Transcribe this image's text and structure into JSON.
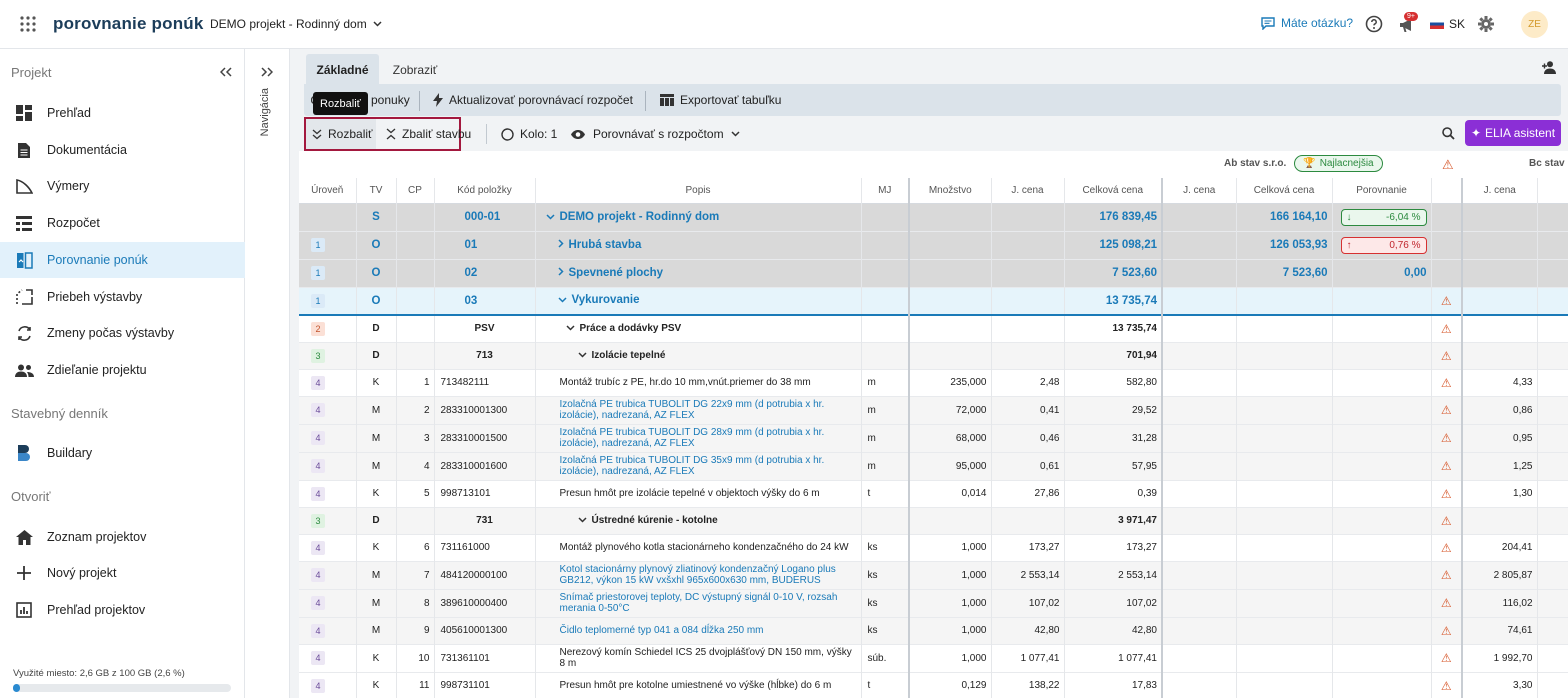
{
  "app": {
    "title": "porovnanie ponúk",
    "project": "DEMO projekt - Rodinný dom",
    "help": "Máte otázku?",
    "notif_badge": "9+",
    "lang": "SK",
    "avatar": "ZE"
  },
  "sidebar": {
    "section_project": "Projekt",
    "items": [
      {
        "label": "Prehľad",
        "icon": "grid-icon"
      },
      {
        "label": "Dokumentácia",
        "icon": "document-icon"
      },
      {
        "label": "Výmery",
        "icon": "ruler-icon"
      },
      {
        "label": "Rozpočet",
        "icon": "budget-icon"
      },
      {
        "label": "Porovnanie ponúk",
        "icon": "compare-icon"
      },
      {
        "label": "Priebeh výstavby",
        "icon": "progress-icon"
      },
      {
        "label": "Zmeny počas výstavby",
        "icon": "changes-icon"
      },
      {
        "label": "Zdieľanie projektu",
        "icon": "users-icon"
      }
    ],
    "section_diary": "Stavebný denník",
    "diary_items": [
      {
        "label": "Buildary",
        "icon": "buildary-icon"
      }
    ],
    "section_open": "Otvoriť",
    "open_items": [
      {
        "label": "Zoznam projektov",
        "icon": "home-icon"
      },
      {
        "label": "Nový projekt",
        "icon": "plus-icon"
      },
      {
        "label": "Prehľad projektov",
        "icon": "chart-icon"
      }
    ],
    "storage": "Využité miesto: 2,6 GB z 100 GB (2,6 %)",
    "storage_fraction": 0.026
  },
  "nav_label": "Navigácia",
  "tabs": [
    {
      "label": "Základné"
    },
    {
      "label": "Zobraziť"
    }
  ],
  "toolbar1": {
    "offers": "ponuky",
    "update": "Aktualizovať porovnávací rozpočet",
    "export": "Exportovať tabuľku"
  },
  "tooltip": "Rozbaliť",
  "toolbar2": {
    "expand": "Rozbaliť",
    "collapse": "Zbaliť stavbu",
    "round": "Kolo: 1",
    "compare": "Porovnávať s rozpočtom",
    "assistant": "ELIA asistent"
  },
  "offer1": {
    "name": "Ab stav s.r.o.",
    "badge": "Najlacnejšia"
  },
  "offer2": {
    "name": "Bc stav"
  },
  "columns": [
    "Úroveň",
    "TV",
    "CP",
    "Kód položky",
    "Popis",
    "MJ",
    "Množstvo",
    "J. cena",
    "Celková cena",
    "J. cena",
    "Celková cena",
    "Porovnanie",
    "",
    "J. cena"
  ],
  "rows": [
    {
      "lvl": "",
      "tv": "S",
      "cp": "",
      "code": "000-01",
      "desc": "DEMO projekt - Rodinný dom",
      "mj": "",
      "qty": "",
      "unit": "",
      "total": "176 839,45",
      "o1u": "",
      "o1t": "166 164,10",
      "cmp": "-6,04 %",
      "cmpType": "down",
      "warn": "",
      "o2u": "",
      "kind": "s"
    },
    {
      "lvl": "1",
      "tv": "O",
      "cp": "",
      "code": "01",
      "desc": "Hrubá stavba",
      "mj": "",
      "qty": "",
      "unit": "",
      "total": "125 098,21",
      "o1u": "",
      "o1t": "126 053,93",
      "cmp": "0,76 %",
      "cmpType": "up",
      "warn": "",
      "o2u": "",
      "kind": "o"
    },
    {
      "lvl": "1",
      "tv": "O",
      "cp": "",
      "code": "02",
      "desc": "Spevnené plochy",
      "mj": "",
      "qty": "",
      "unit": "",
      "total": "7 523,60",
      "o1u": "",
      "o1t": "7 523,60",
      "cmp": "0,00",
      "cmpType": "plain",
      "warn": "",
      "o2u": "",
      "kind": "o"
    },
    {
      "lvl": "1",
      "tv": "O",
      "cp": "",
      "code": "03",
      "desc": "Vykurovanie",
      "mj": "",
      "qty": "",
      "unit": "",
      "total": "13 735,74",
      "o1u": "",
      "o1t": "",
      "cmp": "",
      "cmpType": "",
      "warn": "⚠",
      "o2u": "",
      "kind": "osel"
    },
    {
      "lvl": "2",
      "tv": "D",
      "cp": "",
      "code": "PSV",
      "desc": "Práce a dodávky PSV",
      "mj": "",
      "qty": "",
      "unit": "",
      "total": "13 735,74",
      "o1u": "",
      "o1t": "",
      "cmp": "",
      "cmpType": "",
      "warn": "⚠",
      "o2u": "",
      "kind": "d2"
    },
    {
      "lvl": "3",
      "tv": "D",
      "cp": "",
      "code": "713",
      "desc": "Izolácie tepelné",
      "mj": "",
      "qty": "",
      "unit": "",
      "total": "701,94",
      "o1u": "",
      "o1t": "",
      "cmp": "",
      "cmpType": "",
      "warn": "⚠",
      "o2u": "",
      "kind": "d3"
    },
    {
      "lvl": "4",
      "tv": "K",
      "cp": "1",
      "code": "713482111",
      "desc": "Montáž trubíc z PE, hr.do 10 mm,vnút.priemer do 38 mm",
      "mj": "m",
      "qty": "235,000",
      "unit": "2,48",
      "total": "582,80",
      "o1u": "",
      "o1t": "",
      "cmp": "",
      "cmpType": "",
      "warn": "⚠",
      "o2u": "4,33",
      "kind": "k"
    },
    {
      "lvl": "4",
      "tv": "M",
      "cp": "2",
      "code": "283310001300",
      "desc": "Izolačná PE trubica TUBOLIT DG 22x9 mm (d potrubia x hr. izolácie), nadrezaná, AZ FLEX",
      "mj": "m",
      "qty": "72,000",
      "unit": "0,41",
      "total": "29,52",
      "o1u": "",
      "o1t": "",
      "cmp": "",
      "cmpType": "",
      "warn": "⚠",
      "o2u": "0,86",
      "kind": "m"
    },
    {
      "lvl": "4",
      "tv": "M",
      "cp": "3",
      "code": "283310001500",
      "desc": "Izolačná PE trubica TUBOLIT DG 28x9 mm (d potrubia x hr. izolácie), nadrezaná, AZ FLEX",
      "mj": "m",
      "qty": "68,000",
      "unit": "0,46",
      "total": "31,28",
      "o1u": "",
      "o1t": "",
      "cmp": "",
      "cmpType": "",
      "warn": "⚠",
      "o2u": "0,95",
      "kind": "m"
    },
    {
      "lvl": "4",
      "tv": "M",
      "cp": "4",
      "code": "283310001600",
      "desc": "Izolačná PE trubica TUBOLIT DG 35x9 mm (d potrubia x hr. izolácie), nadrezaná, AZ FLEX",
      "mj": "m",
      "qty": "95,000",
      "unit": "0,61",
      "total": "57,95",
      "o1u": "",
      "o1t": "",
      "cmp": "",
      "cmpType": "",
      "warn": "⚠",
      "o2u": "1,25",
      "kind": "m"
    },
    {
      "lvl": "4",
      "tv": "K",
      "cp": "5",
      "code": "998713101",
      "desc": "Presun hmôt pre izolácie tepelné v objektoch výšky do 6 m",
      "mj": "t",
      "qty": "0,014",
      "unit": "27,86",
      "total": "0,39",
      "o1u": "",
      "o1t": "",
      "cmp": "",
      "cmpType": "",
      "warn": "⚠",
      "o2u": "1,30",
      "kind": "k"
    },
    {
      "lvl": "3",
      "tv": "D",
      "cp": "",
      "code": "731",
      "desc": "Ústredné kúrenie - kotolne",
      "mj": "",
      "qty": "",
      "unit": "",
      "total": "3 971,47",
      "o1u": "",
      "o1t": "",
      "cmp": "",
      "cmpType": "",
      "warn": "⚠",
      "o2u": "",
      "kind": "d3"
    },
    {
      "lvl": "4",
      "tv": "K",
      "cp": "6",
      "code": "731161000",
      "desc": "Montáž plynového kotla stacionárneho kondenzačného do 24 kW",
      "mj": "ks",
      "qty": "1,000",
      "unit": "173,27",
      "total": "173,27",
      "o1u": "",
      "o1t": "",
      "cmp": "",
      "cmpType": "",
      "warn": "⚠",
      "o2u": "204,41",
      "kind": "k"
    },
    {
      "lvl": "4",
      "tv": "M",
      "cp": "7",
      "code": "484120000100",
      "desc": "Kotol stacionárny plynový zliatinový kondenzačný Logano plus GB212, výkon 15 kW vxšxhl 965x600x630 mm, BUDERUS",
      "mj": "ks",
      "qty": "1,000",
      "unit": "2 553,14",
      "total": "2 553,14",
      "o1u": "",
      "o1t": "",
      "cmp": "",
      "cmpType": "",
      "warn": "⚠",
      "o2u": "2 805,87",
      "kind": "m"
    },
    {
      "lvl": "4",
      "tv": "M",
      "cp": "8",
      "code": "389610000400",
      "desc": "Snímač priestorovej teploty, DC výstupný signál 0-10 V, rozsah merania 0-50°C",
      "mj": "ks",
      "qty": "1,000",
      "unit": "107,02",
      "total": "107,02",
      "o1u": "",
      "o1t": "",
      "cmp": "",
      "cmpType": "",
      "warn": "⚠",
      "o2u": "116,02",
      "kind": "m"
    },
    {
      "lvl": "4",
      "tv": "M",
      "cp": "9",
      "code": "405610001300",
      "desc": "Čidlo teplomerné typ 041 a 084 dĺžka 250 mm",
      "mj": "ks",
      "qty": "1,000",
      "unit": "42,80",
      "total": "42,80",
      "o1u": "",
      "o1t": "",
      "cmp": "",
      "cmpType": "",
      "warn": "⚠",
      "o2u": "74,61",
      "kind": "m"
    },
    {
      "lvl": "4",
      "tv": "K",
      "cp": "10",
      "code": "731361101",
      "desc": "Nerezový komín Schiedel ICS 25 dvojplášťový DN 150 mm, výšky 8 m",
      "mj": "súb.",
      "qty": "1,000",
      "unit": "1 077,41",
      "total": "1 077,41",
      "o1u": "",
      "o1t": "",
      "cmp": "",
      "cmpType": "",
      "warn": "⚠",
      "o2u": "1 992,70",
      "kind": "k"
    },
    {
      "lvl": "4",
      "tv": "K",
      "cp": "11",
      "code": "998731101",
      "desc": "Presun hmôt pre kotolne umiestnené vo výške (hĺbke) do 6 m",
      "mj": "t",
      "qty": "0,129",
      "unit": "138,22",
      "total": "17,83",
      "o1u": "",
      "o1t": "",
      "cmp": "",
      "cmpType": "",
      "warn": "⚠",
      "o2u": "3,30",
      "kind": "k"
    }
  ]
}
